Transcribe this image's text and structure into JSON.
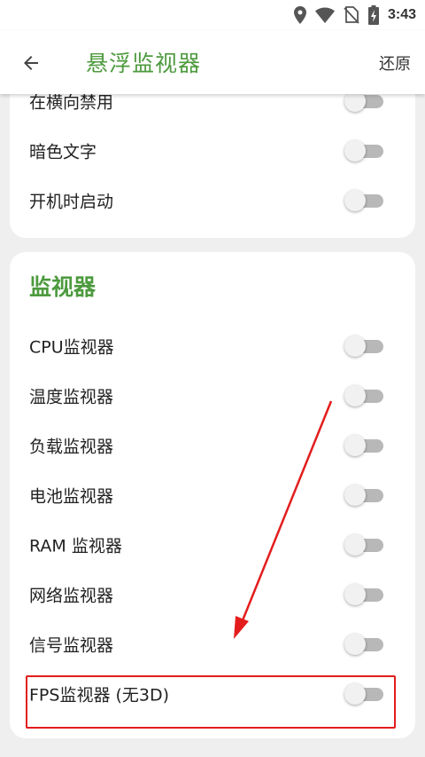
{
  "statusbar": {
    "time": "3:43",
    "icons": [
      "location-icon",
      "wifi-icon",
      "no-sim-icon",
      "battery-charging-icon"
    ]
  },
  "appbar": {
    "title": "悬浮监视器",
    "restore_label": "还原"
  },
  "general": {
    "items": [
      {
        "label": "在横向禁用",
        "checked": false
      },
      {
        "label": "暗色文字",
        "checked": false
      },
      {
        "label": "开机时启动",
        "checked": false
      }
    ]
  },
  "monitors": {
    "title": "监视器",
    "items": [
      {
        "label": "CPU监视器",
        "checked": false
      },
      {
        "label": "温度监视器",
        "checked": false
      },
      {
        "label": "负载监视器",
        "checked": false
      },
      {
        "label": "电池监视器",
        "checked": false
      },
      {
        "label": "RAM 监视器",
        "checked": false
      },
      {
        "label": "网络监视器",
        "checked": false
      },
      {
        "label": "信号监视器",
        "checked": false
      },
      {
        "label": "FPS监视器 (无3D)",
        "checked": false
      }
    ]
  },
  "colors": {
    "accent_green": "#4d9a3e",
    "annotation_red": "#e31d1d"
  }
}
